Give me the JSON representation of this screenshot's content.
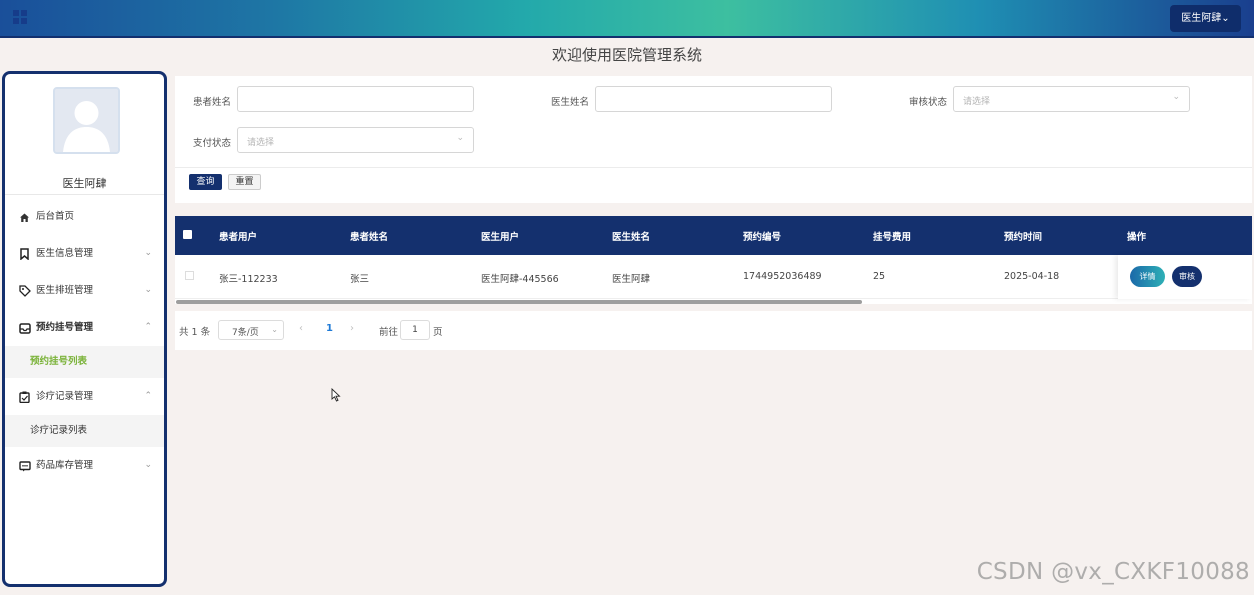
{
  "header": {
    "user_menu_label": "医生阿肆",
    "user_menu_arrow": "⌄"
  },
  "page_title": "欢迎使用医院管理系统",
  "sidebar": {
    "user_name": "医生阿肆",
    "menu": [
      {
        "label": "后台首页",
        "icon": "home-icon"
      },
      {
        "label": "医生信息管理",
        "icon": "bookmark-icon",
        "arrow": "⌄"
      },
      {
        "label": "医生排班管理",
        "icon": "tag-icon",
        "arrow": "⌄"
      },
      {
        "label": "预约挂号管理",
        "icon": "inbox-icon",
        "arrow": "⌃",
        "expanded": true
      },
      {
        "label": "预约挂号列表"
      },
      {
        "label": "诊疗记录管理",
        "icon": "clipboard-icon",
        "arrow": "⌃",
        "expanded": true
      },
      {
        "label": "诊疗记录列表"
      },
      {
        "label": "药品库存管理",
        "icon": "message-icon",
        "arrow": "⌄"
      }
    ]
  },
  "search": {
    "patient_name_label": "患者姓名",
    "patient_name_value": "",
    "doctor_name_label": "医生姓名",
    "doctor_name_value": "",
    "audit_status_label": "审核状态",
    "audit_status_placeholder": "请选择",
    "pay_status_label": "支付状态",
    "pay_status_placeholder": "请选择",
    "query_button": "查询",
    "reset_button": "重置"
  },
  "table": {
    "columns": [
      "患者用户",
      "患者姓名",
      "医生用户",
      "医生姓名",
      "预约编号",
      "挂号费用",
      "预约时间",
      "操作"
    ],
    "rows": [
      {
        "patient_user": "张三-112233",
        "patient_name": "张三",
        "doctor_user": "医生阿肆-445566",
        "doctor_name": "医生阿肆",
        "appointment_no": "1744952036489",
        "fee": "25",
        "appointment_time": "2025-04-18",
        "detail_button": "详情",
        "audit_button": "审核"
      }
    ]
  },
  "pagination": {
    "total_text": "共 1 条",
    "page_size": "7条/页",
    "current_page": "1",
    "goto_label": "前往",
    "goto_value": "1",
    "page_suffix": "页"
  },
  "watermark": "CSDN @vx_CXKF10088",
  "colors": {
    "primary": "#14306e",
    "active_submenu": "#7bb33a",
    "page_bg": "#f6f1ef"
  }
}
